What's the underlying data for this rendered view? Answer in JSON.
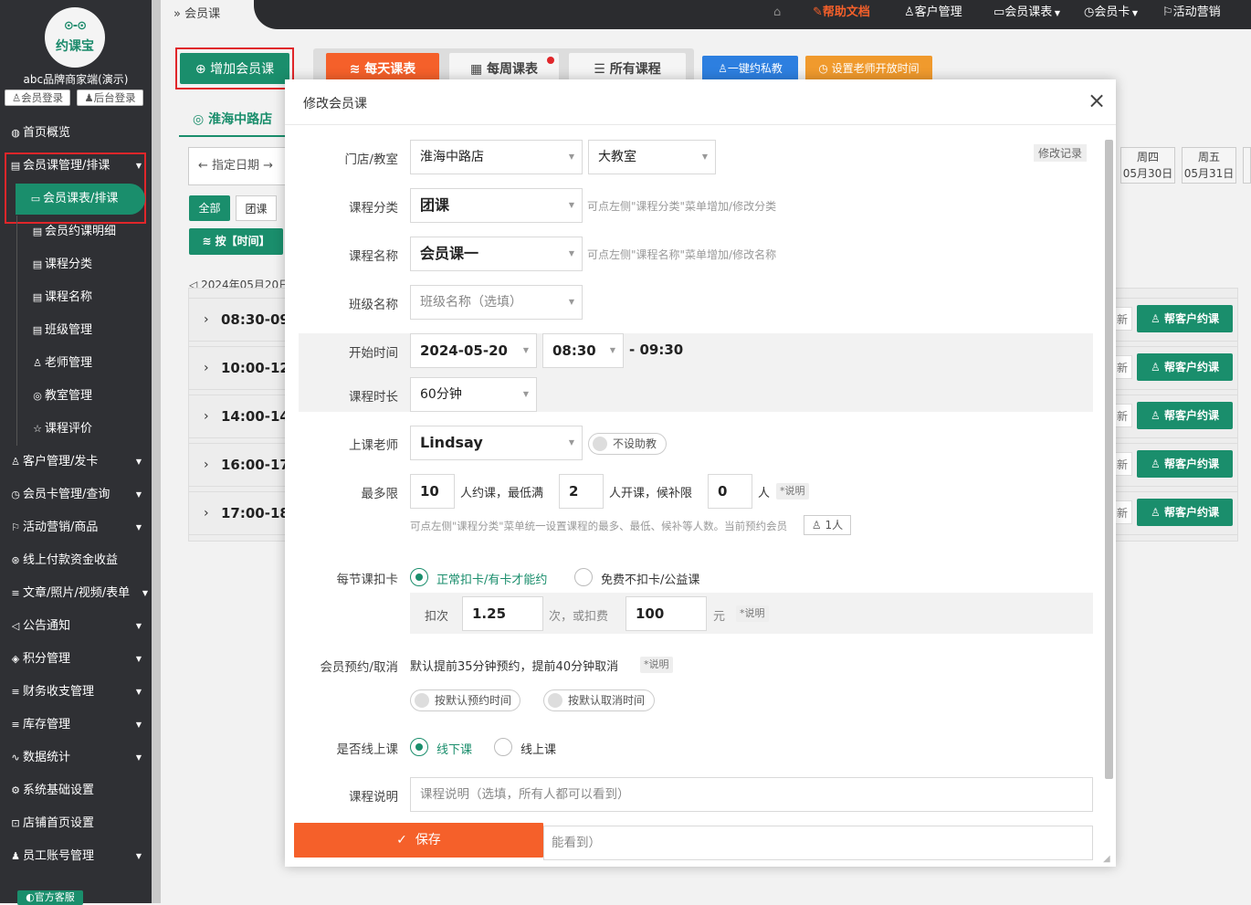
{
  "sidebar": {
    "logo_eyes": "⊙-⊙",
    "logo_text": "约课宝",
    "shop_name": "abc品牌商家端(演示)",
    "member_login": "会员登录",
    "admin_login": "后台登录",
    "items": [
      {
        "icon": "◍",
        "label": "首页概览"
      },
      {
        "icon": "▤",
        "label": "会员课管理/排课"
      },
      {
        "icon": "♙",
        "label": "客户管理/发卡"
      },
      {
        "icon": "◷",
        "label": "会员卡管理/查询"
      },
      {
        "icon": "⚐",
        "label": "活动营销/商品"
      },
      {
        "icon": "⊛",
        "label": "线上付款资金收益"
      },
      {
        "icon": "≡",
        "label": "文章/照片/视频/表单"
      },
      {
        "icon": "◁",
        "label": "公告通知"
      },
      {
        "icon": "◈",
        "label": "积分管理"
      },
      {
        "icon": "≡",
        "label": "财务收支管理"
      },
      {
        "icon": "≡",
        "label": "库存管理"
      },
      {
        "icon": "∿",
        "label": "数据统计"
      },
      {
        "icon": "⚙",
        "label": "系统基础设置"
      },
      {
        "icon": "⊡",
        "label": "店铺首页设置"
      },
      {
        "icon": "♟",
        "label": "员工账号管理"
      }
    ],
    "subitems": [
      {
        "icon": "▭",
        "label": "会员课表/排课"
      },
      {
        "icon": "▤",
        "label": "会员约课明细"
      },
      {
        "icon": "▤",
        "label": "课程分类"
      },
      {
        "icon": "▤",
        "label": "课程名称"
      },
      {
        "icon": "▤",
        "label": "班级管理"
      },
      {
        "icon": "♙",
        "label": "老师管理"
      },
      {
        "icon": "◎",
        "label": "教室管理"
      },
      {
        "icon": "☆",
        "label": "课程评价"
      }
    ],
    "service": "官方客服"
  },
  "breadcrumb": "会员课",
  "topnav": {
    "home_icon": "⌂",
    "help": "帮助文档",
    "customers": "客户管理",
    "schedule": "会员课表",
    "cards": "会员卡",
    "marketing": "活动营销"
  },
  "toolbar": {
    "add": "增加会员课",
    "daily": "每天课表",
    "weekly": "每周课表",
    "all": "所有课程",
    "private": "一键约私教",
    "teacher_time": "设置老师开放时间"
  },
  "store_tab": "淮海中路店",
  "date_picker": "← 指定日期 →",
  "filters": {
    "all": "全部",
    "group": "团课"
  },
  "by_time": "按【时间】",
  "date_text": "2024年05月20日",
  "days": [
    {
      "weekday": "周四",
      "date": "05月30日"
    },
    {
      "weekday": "周五",
      "date": "05月31日"
    }
  ],
  "rows": [
    {
      "time": "08:30-09:"
    },
    {
      "time": "10:00-12:"
    },
    {
      "time": "14:00-14:"
    },
    {
      "time": "16:00-17:"
    },
    {
      "time": "17:00-18:"
    }
  ],
  "row_new": "新",
  "row_action": "帮客户约课",
  "modal": {
    "title": "修改会员课",
    "close": "×",
    "edit_log": "修改记录",
    "labels": {
      "store": "门店/教室",
      "category": "课程分类",
      "course": "课程名称",
      "class": "班级名称",
      "start": "开始时间",
      "duration": "课程时长",
      "teacher": "上课老师",
      "limits": "最多限",
      "deduct": "每节课扣卡",
      "booking": "会员预约/取消",
      "online": "是否线上课",
      "desc": "课程说明"
    },
    "store": "淮海中路店",
    "room": "大教室",
    "category": "团课",
    "category_hint": "可点左侧\"课程分类\"菜单增加/修改分类",
    "course": "会员课一",
    "course_hint": "可点左侧\"课程名称\"菜单增加/修改名称",
    "class_placeholder": "班级名称（选填）",
    "date": "2024-05-20",
    "time": "08:30",
    "end_time": "- 09:30",
    "duration": "60分钟",
    "teacher": "Lindsay",
    "no_assistant": "不设助教",
    "max": "10",
    "max_unit": "人约课，最低满",
    "min": "2",
    "min_unit": "人开课，候补限",
    "wait": "0",
    "wait_unit": "人",
    "explain": "*说明",
    "limit_hint": "可点左侧\"课程分类\"菜单统一设置课程的最多、最低、候补等人数。当前预约会员",
    "booked": "1人",
    "deduct_normal": "正常扣卡/有卡才能约",
    "deduct_free": "免费不扣卡/公益课",
    "deduct_times_label": "扣次",
    "deduct_times": "1.25",
    "deduct_or": "次，或扣费",
    "deduct_fee": "100",
    "deduct_unit": "元",
    "booking_text": "默认提前35分钟预约，提前40分钟取消",
    "booking_toggle": "按默认预约时间",
    "cancel_toggle": "按默认取消时间",
    "offline": "线下课",
    "onlinecourse": "线上课",
    "desc_placeholder": "课程说明（选填，所有人都可以看到）",
    "desc2_partial": "能看到）",
    "save": "保存"
  },
  "colors": {
    "green": "#1a8e6c",
    "orange": "#f5602a",
    "red": "#e0262a"
  }
}
